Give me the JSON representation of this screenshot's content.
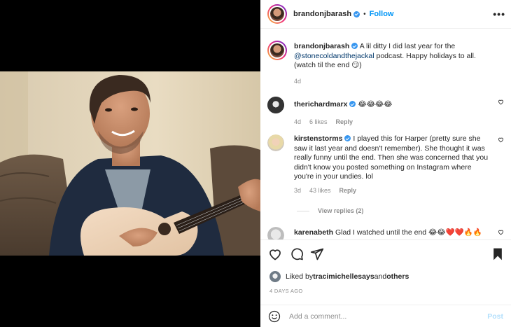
{
  "header": {
    "username": "brandonjbarash",
    "follow_label": "Follow",
    "separator": "•",
    "more_label": "•••"
  },
  "caption": {
    "username": "brandonjbarash",
    "text_before": " A lil ditty I did last year for the ",
    "mention": "@stonecoldandthejackal",
    "text_after": " podcast. Happy holidays to all. (watch til the end 😏)",
    "time": "4d"
  },
  "comments": [
    {
      "username": "therichardmarx",
      "text": " 😂😂😂😂",
      "time": "4d",
      "likes": "6 likes",
      "reply": "Reply"
    },
    {
      "username": "kirstenstorms",
      "text": " I played this for Harper (pretty sure she saw it last year and doesn't remember). She thought it was really funny until the end. Then she was concerned that you didn't know you posted something on Instagram where you're in your undies. lol",
      "time": "3d",
      "likes": "43 likes",
      "reply": "Reply"
    },
    {
      "username": "karenabeth",
      "text": " Glad I watched until the end 😂😂❤️❤️🔥🔥"
    }
  ],
  "view_replies": "View replies (2)",
  "likes": {
    "prefix": "Liked by ",
    "user": "tracimichellesays",
    "middle": " and ",
    "others": "others"
  },
  "posted_ago": "4 DAYS AGO",
  "add_comment": {
    "placeholder": "Add a comment...",
    "post_label": "Post"
  },
  "colors": {
    "accent": "#0095f6",
    "post_disabled": "#b2dffc",
    "muted": "#8e8e8e"
  }
}
